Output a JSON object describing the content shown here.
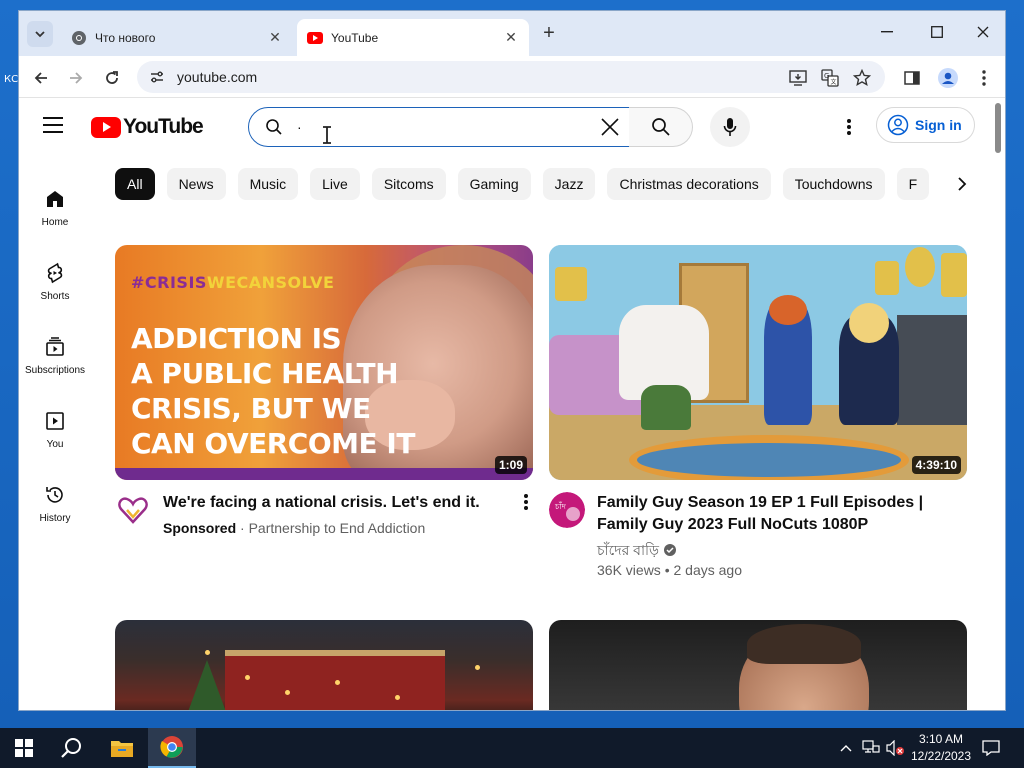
{
  "desktop": {
    "label": "КС"
  },
  "browser": {
    "tabs": [
      {
        "title": "Что нового",
        "active": false
      },
      {
        "title": "YouTube",
        "active": true
      }
    ],
    "url": "youtube.com"
  },
  "youtube": {
    "logo_text": "YouTube",
    "search": {
      "value": "·"
    },
    "signin_label": "Sign in",
    "sidebar": [
      {
        "label": "Home",
        "icon": "home-icon"
      },
      {
        "label": "Shorts",
        "icon": "shorts-icon"
      },
      {
        "label": "Subscriptions",
        "icon": "subscriptions-icon"
      },
      {
        "label": "You",
        "icon": "you-icon"
      },
      {
        "label": "History",
        "icon": "history-icon"
      }
    ],
    "chips": [
      "All",
      "News",
      "Music",
      "Live",
      "Sitcoms",
      "Gaming",
      "Jazz",
      "Christmas decorations",
      "Touchdowns",
      "F"
    ],
    "videos": [
      {
        "title": "We're facing a national crisis. Let's end it.",
        "sponsored_label": "Sponsored",
        "channel": "Partnership to End Addiction",
        "duration": "1:09",
        "thumb_hashtag_a": "#CRISIS",
        "thumb_hashtag_b": "WECANSOLVE",
        "thumb_headline_1": "ADDICTION IS",
        "thumb_headline_2": "A PUBLIC HEALTH",
        "thumb_headline_3": "CRISIS, BUT WE",
        "thumb_headline_4": "CAN OVERCOME IT"
      },
      {
        "title_line1": "Family Guy Season 19 EP 1 Full Episodes |",
        "title_line2": "Family Guy 2023 Full NoCuts 1080P",
        "channel": "চাঁদের বাড়ি",
        "views": "36K views",
        "age": "2 days ago",
        "duration": "4:39:10"
      }
    ]
  },
  "taskbar": {
    "time": "3:10 AM",
    "date": "12/22/2023"
  },
  "colors": {
    "yt_red": "#ff0000",
    "link_blue": "#065fd4",
    "chip_active": "#0f0f0f"
  }
}
